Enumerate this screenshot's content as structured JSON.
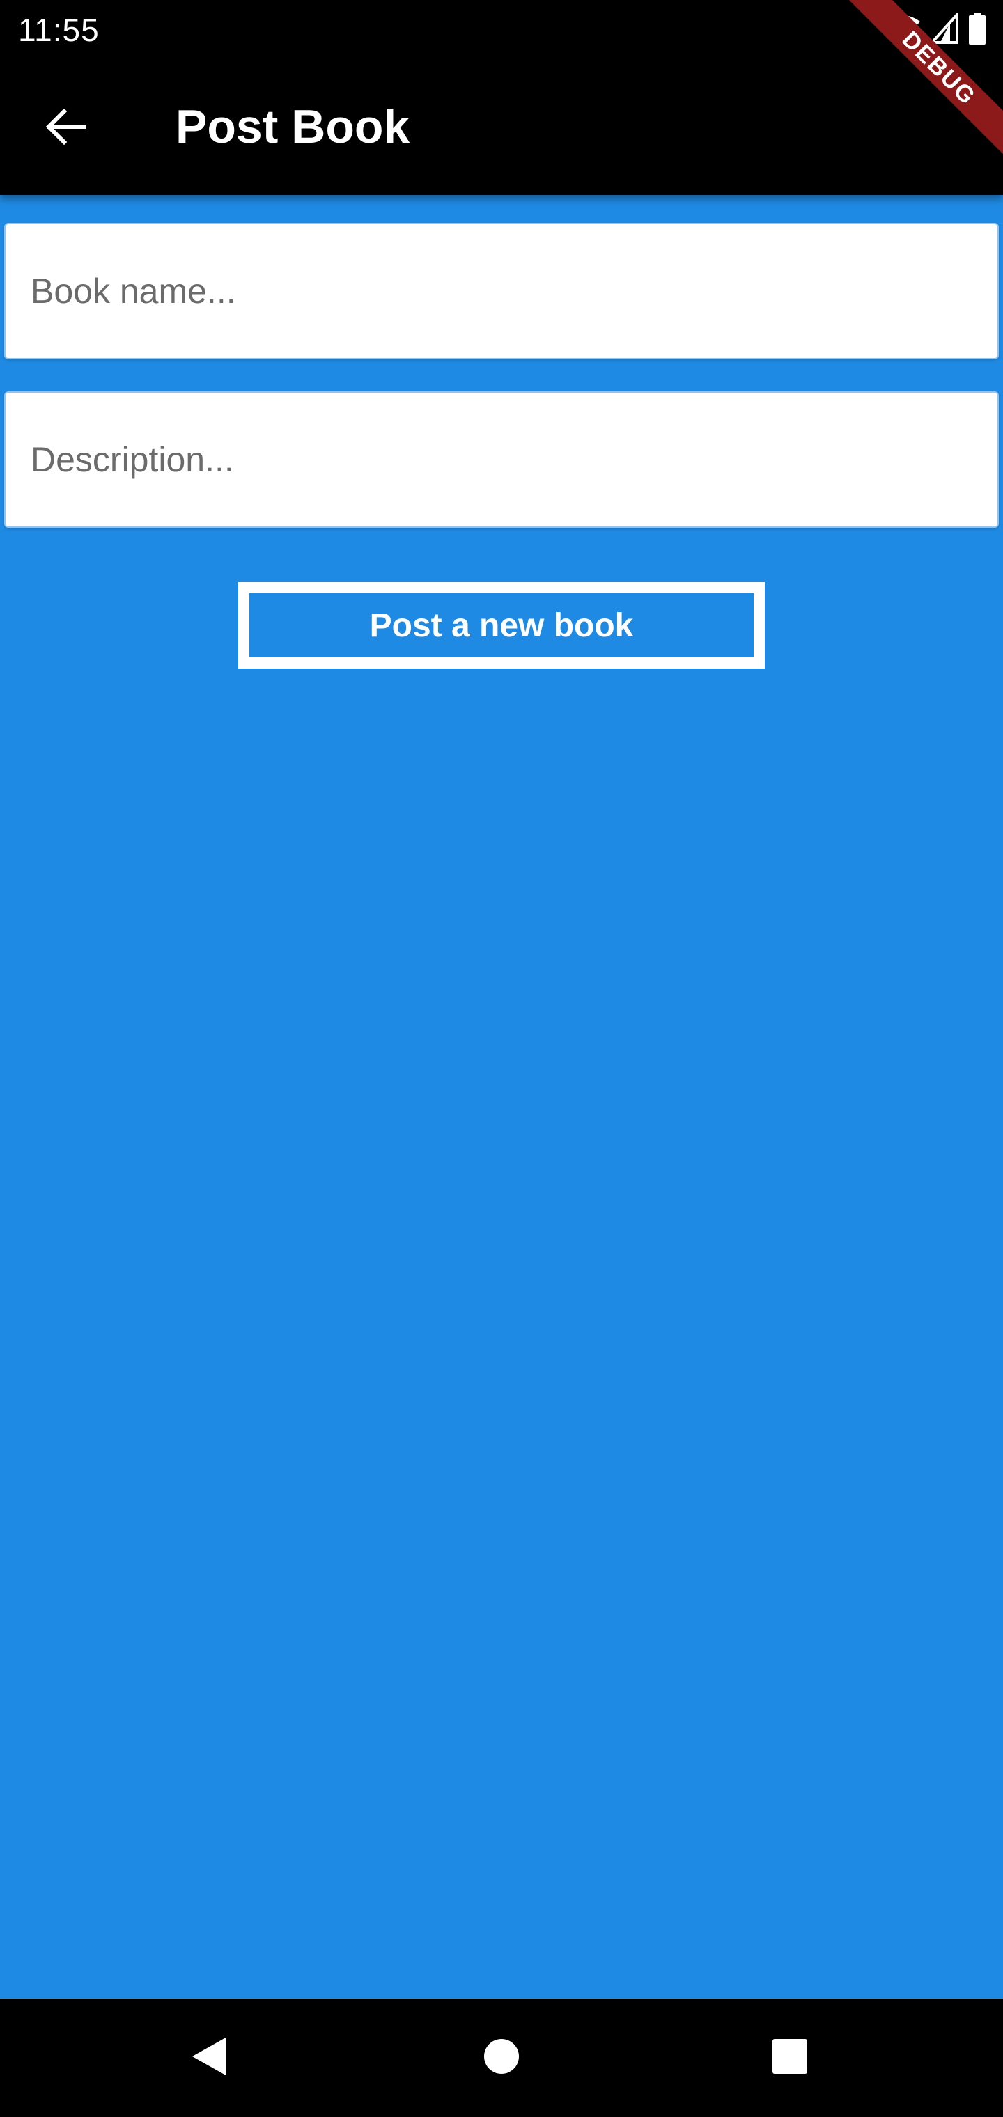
{
  "status_bar": {
    "time": "11:55",
    "icons": [
      "wifi-icon",
      "cell-signal-icon",
      "battery-icon"
    ]
  },
  "app_bar": {
    "back_icon": "arrow-back-icon",
    "title": "Post Book"
  },
  "debug_banner": {
    "label": "DEBUG"
  },
  "form": {
    "book_name": {
      "value": "",
      "placeholder": "Book name..."
    },
    "description": {
      "value": "",
      "placeholder": "Description..."
    },
    "submit_label": "Post a new book"
  },
  "nav_bar": {
    "icons": [
      "nav-back-icon",
      "nav-home-icon",
      "nav-recents-icon"
    ]
  },
  "colors": {
    "background": "#1f8ae3",
    "app_bar": "#000000",
    "debug_banner": "#8c1a1a",
    "field_background": "#ffffff",
    "button_border": "#ffffff"
  }
}
